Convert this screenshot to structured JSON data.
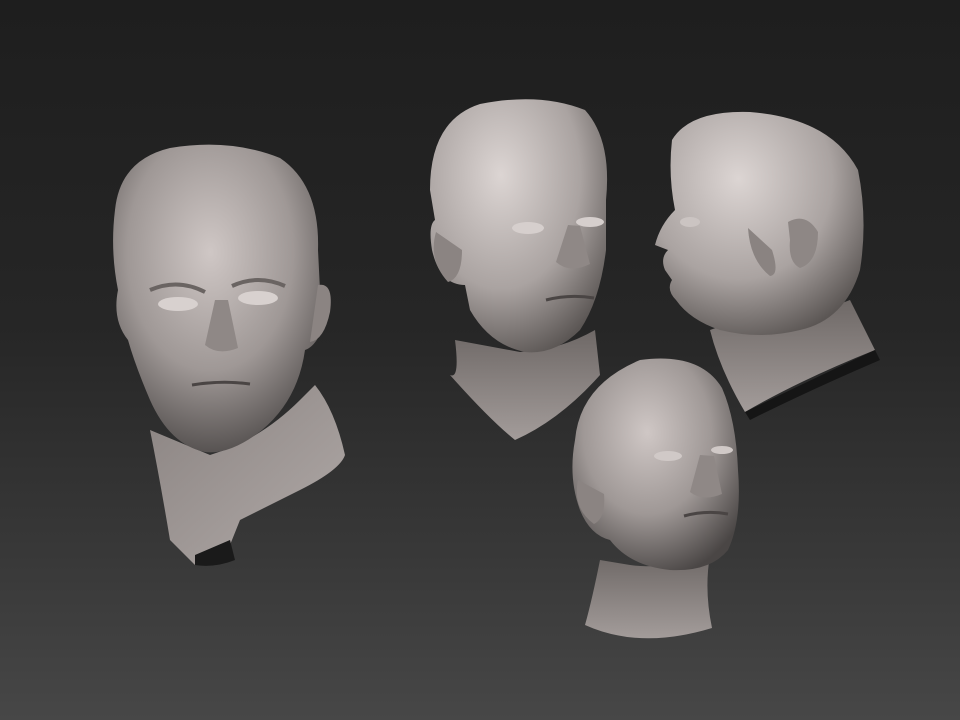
{
  "scene": {
    "background_top": "#1e1e1e",
    "background_bottom": "#474747",
    "material_color": "#b5adab",
    "subjects": [
      {
        "name": "head-front-three-quarter",
        "view": "front"
      },
      {
        "name": "head-front-slight-turn",
        "view": "three-quarter"
      },
      {
        "name": "head-profile-left",
        "view": "profile"
      },
      {
        "name": "head-low-angle",
        "view": "low-angle"
      }
    ]
  }
}
